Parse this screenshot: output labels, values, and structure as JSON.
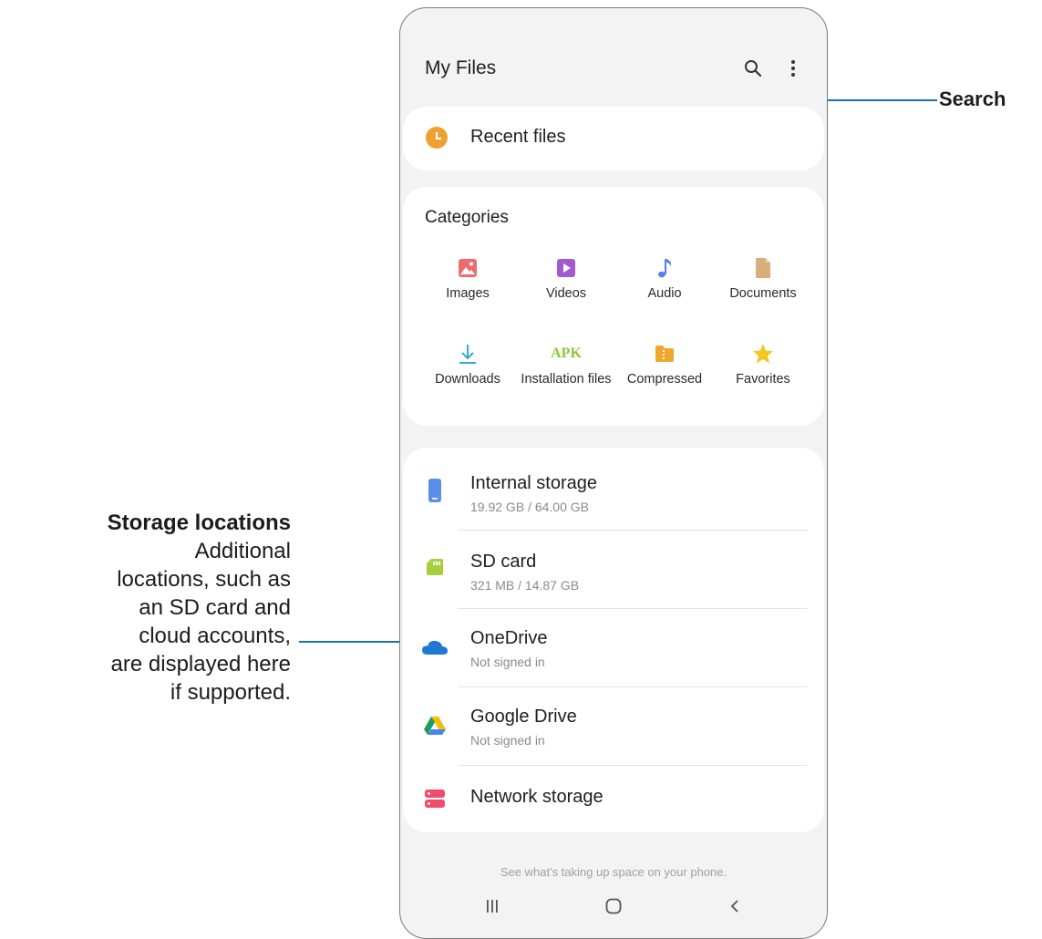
{
  "header": {
    "title": "My Files",
    "search_icon": "search-icon",
    "more_icon": "more-vert-icon"
  },
  "recent": {
    "label": "Recent files",
    "icon": "clock-icon",
    "color": "#f0a030"
  },
  "categories": {
    "title": "Categories",
    "items": [
      {
        "label": "Images",
        "icon": "image-icon",
        "color": "#ef6b6b"
      },
      {
        "label": "Videos",
        "icon": "video-icon",
        "color": "#a25ad0"
      },
      {
        "label": "Audio",
        "icon": "music-note-icon",
        "color": "#5b7fe0"
      },
      {
        "label": "Documents",
        "icon": "document-icon",
        "color": "#d9ae7b"
      },
      {
        "label": "Downloads",
        "icon": "download-icon",
        "color": "#36a8d8"
      },
      {
        "label": "Installation files",
        "icon": "apk-icon",
        "icon_text": "APK",
        "color": "#8fc63c"
      },
      {
        "label": "Compressed",
        "icon": "folder-zip-icon",
        "color": "#f3a72a"
      },
      {
        "label": "Favorites",
        "icon": "star-icon",
        "color": "#f3c623"
      }
    ]
  },
  "storage": [
    {
      "name": "Internal storage",
      "detail": "19.92 GB / 64.00 GB",
      "icon": "phone-icon",
      "color": "#5b8ee6"
    },
    {
      "name": "SD card",
      "detail": "321 MB / 14.87 GB",
      "icon": "sd-card-icon",
      "color": "#a6cf3c"
    },
    {
      "name": "OneDrive",
      "detail": "Not signed in",
      "icon": "onedrive-icon",
      "color": "#1e78d4"
    },
    {
      "name": "Google Drive",
      "detail": "Not signed in",
      "icon": "google-drive-icon",
      "color": "#1a9e5c"
    },
    {
      "name": "Network storage",
      "detail": "",
      "icon": "network-storage-icon",
      "color": "#ef4d6a"
    }
  ],
  "hint": "See what's taking up space on your phone.",
  "nav": {
    "recents_icon": "recents-icon",
    "home_icon": "home-icon",
    "back_icon": "back-icon"
  },
  "callouts": {
    "search": "Search",
    "storage_title": "Storage locations",
    "storage_body": [
      "Additional",
      "locations, such as",
      "an SD card and",
      "cloud accounts,",
      "are displayed here",
      "if supported."
    ],
    "color": "#1b6fa6"
  }
}
